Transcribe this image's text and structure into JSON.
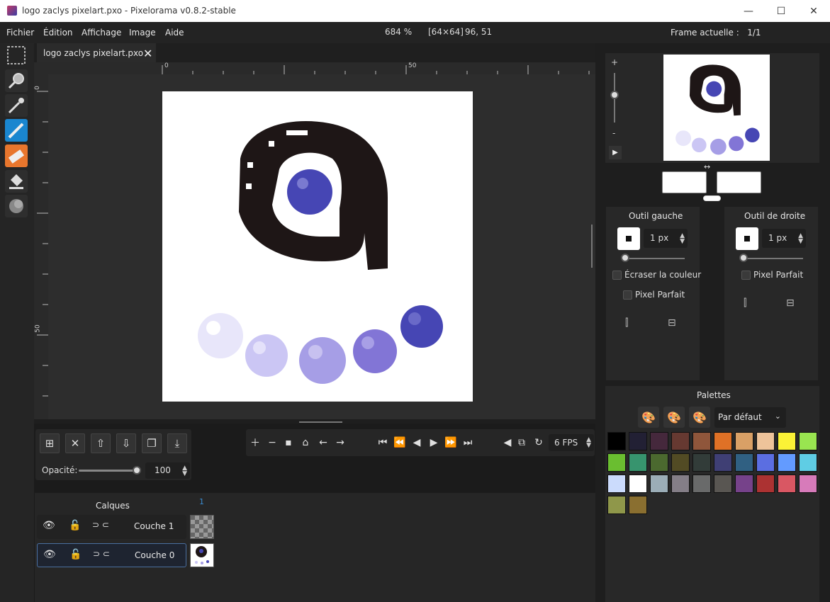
{
  "window": {
    "title": "logo zaclys pixelart.pxo - Pixelorama v0.8.2-stable",
    "minimize": "—",
    "maximize": "☐",
    "close": "✕"
  },
  "menu": [
    "Fichier",
    "Édition",
    "Affichage",
    "Image",
    "Aide"
  ],
  "status": {
    "zoom": "684 %",
    "size": "[64×64]",
    "coords": "96, 51",
    "frame_label": "Frame actuelle :",
    "frame_value": "1/1"
  },
  "tab": {
    "label": "logo zaclys pixelart.pxo",
    "close": "✕"
  },
  "rulers": {
    "h_ticks": [
      "0",
      "50"
    ],
    "v_ticks": [
      "0",
      "50"
    ]
  },
  "tools": [
    "rect-select",
    "zoom",
    "color-picker",
    "pencil",
    "eraser",
    "bucket",
    "shading"
  ],
  "layer_buttons": [
    "add-layer",
    "remove-layer",
    "move-up",
    "move-down",
    "clone-layer",
    "merge-down"
  ],
  "opacity": {
    "label": "Opacité:",
    "value": "100"
  },
  "animation": {
    "fps": "6 FPS"
  },
  "layers": {
    "title": "Calques",
    "frame_number": "1",
    "items": [
      {
        "name": "Couche 1",
        "selected": false
      },
      {
        "name": "Couche 0",
        "selected": true
      }
    ]
  },
  "left_tool": {
    "title": "Outil gauche",
    "size": "1 px",
    "overwrite": "Écraser la couleur",
    "pixel_perfect": "Pixel Parfait"
  },
  "right_tool": {
    "title": "Outil de droite",
    "size": "1 px",
    "pixel_perfect": "Pixel Parfait"
  },
  "palette": {
    "title": "Palettes",
    "selected": "Par défaut",
    "colors": [
      "#000000",
      "#222034",
      "#45283c",
      "#663931",
      "#8f563b",
      "#df7126",
      "#d9a066",
      "#eec39a",
      "#fbf236",
      "#99e550",
      "#6abe30",
      "#37946e",
      "#4b692f",
      "#524b24",
      "#323c39",
      "#3f3f74",
      "#306082",
      "#5b6ee1",
      "#639bff",
      "#5fcde4",
      "#cbdbfc",
      "#ffffff",
      "#9badb7",
      "#847e87",
      "#696a6a",
      "#595652",
      "#76428a",
      "#ac3232",
      "#d95763",
      "#d77bba",
      "#8f974a",
      "#8a6f30"
    ]
  },
  "colors": {
    "accent_left": "#1a86cf",
    "accent_right": "#e8762d",
    "logo_dark": "#1e1616",
    "logo_blue": "#4646b4"
  }
}
